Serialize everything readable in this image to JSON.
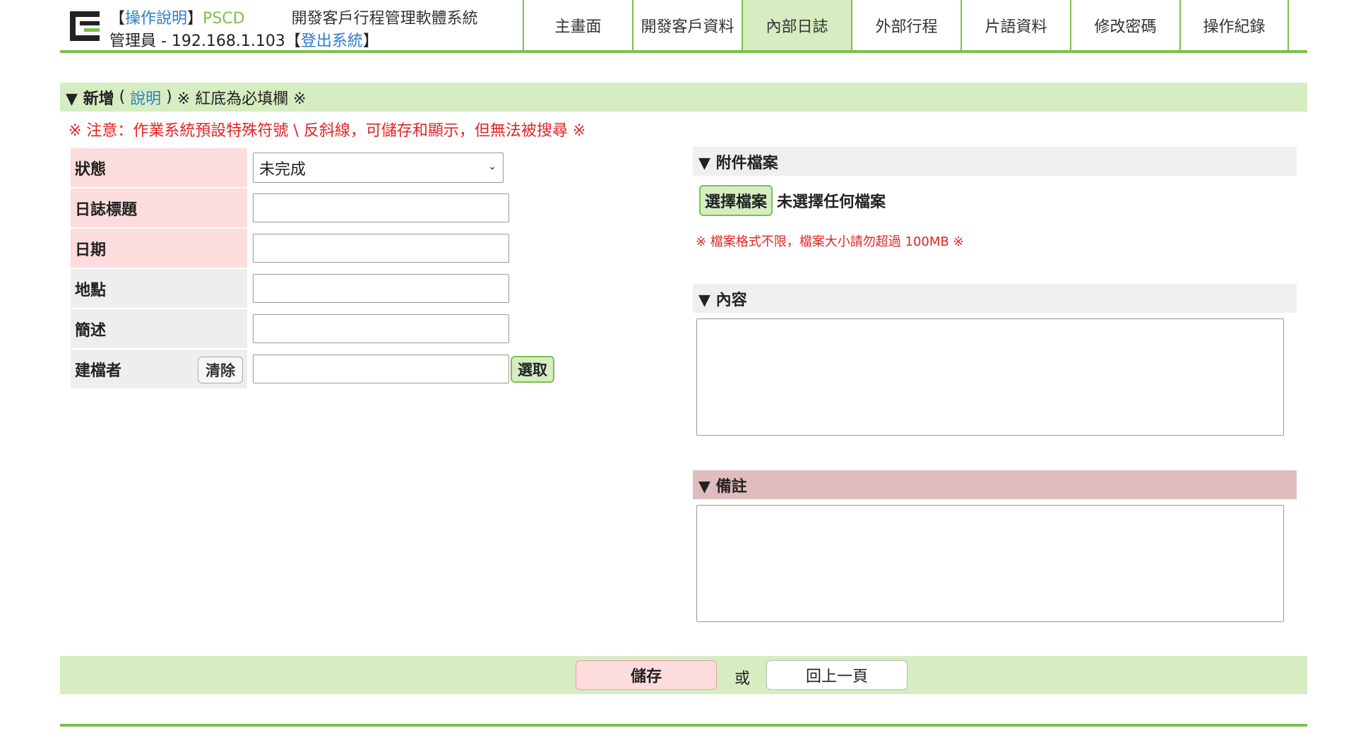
{
  "header": {
    "bracket_open": "【",
    "help_link": "操作說明",
    "bracket_close": "】",
    "brand": "PSCD",
    "system_name": "開發客戶行程管理軟體系統",
    "user_info": "管理員 - 192.168.1.103",
    "logout_bracket_open": "【",
    "logout_link": "登出系統",
    "logout_bracket_close": "】"
  },
  "nav": {
    "items": [
      {
        "label": "主畫面"
      },
      {
        "label": "開發客戶資料"
      },
      {
        "label": "內部日誌"
      },
      {
        "label": "外部行程"
      },
      {
        "label": "片語資料"
      },
      {
        "label": "修改密碼"
      },
      {
        "label": "操作紀錄"
      }
    ],
    "active_index": 2
  },
  "section": {
    "title": "▼ 新增",
    "paren_open": " ( ",
    "help_link": "說明",
    "paren_close": " ) ",
    "note": "※ 紅底為必填欄 ※"
  },
  "warning": "※ 注意：作業系統預設特殊符號 \\ 反斜線，可儲存和顯示，但無法被搜尋 ※",
  "form": {
    "status_label": "狀態",
    "status_value": "未完成",
    "title_label": "日誌標題",
    "date_label": "日期",
    "location_label": "地點",
    "summary_label": "簡述",
    "creator_label": "建檔者",
    "clear_button": "清除",
    "pick_button": "選取"
  },
  "attachments": {
    "heading": "▼ 附件檔案",
    "choose_button": "選擇檔案",
    "no_file_text": "未選擇任何檔案",
    "note": "※ 檔案格式不限，檔案大小請勿超過 100MB ※"
  },
  "content": {
    "heading": "▼ 內容"
  },
  "remarks": {
    "heading": "▼ 備註"
  },
  "footer": {
    "save_button": "儲存",
    "or_text": "或",
    "back_button": "回上一頁"
  },
  "colors": {
    "accent_green": "#7cc04a",
    "light_green": "#d6edc2",
    "required_pink": "#fcdcdc",
    "warning_red": "#e02424",
    "link_blue": "#2a7fc9"
  }
}
